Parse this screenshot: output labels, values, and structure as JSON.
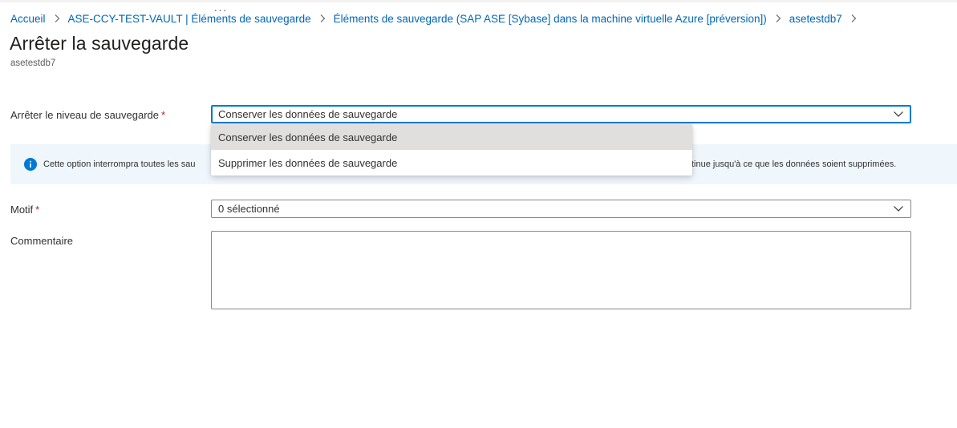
{
  "breadcrumb": {
    "items": [
      "Accueil",
      "ASE-CCY-TEST-VAULT | Éléments de sauvegarde",
      "Éléments de sauvegarde (SAP ASE [Sybase] dans la machine virtuelle Azure [préversion])",
      "asetestdb7"
    ]
  },
  "header": {
    "title": "Arrêter la sauvegarde",
    "more_label": "···",
    "subtitle": "asetestdb7"
  },
  "form": {
    "stop_level": {
      "label": "Arrêter le niveau de sauvegarde",
      "required_mark": "*",
      "value": "Conserver les données de sauvegarde",
      "options": [
        "Conserver les données de sauvegarde",
        "Supprimer les données de sauvegarde"
      ]
    },
    "info": {
      "text_visible_left": "Cette option interrompra toutes les sau",
      "text_visible_right": "tinue jusqu'à ce que les données soient supprimées."
    },
    "reason": {
      "label": "Motif",
      "required_mark": "*",
      "value": "0 sélectionné"
    },
    "comment": {
      "label": "Commentaire",
      "value": ""
    }
  },
  "colors": {
    "link": "#0067b8",
    "accent": "#0078d4",
    "info_background": "#eff6fc",
    "required": "#a4262c",
    "menu_selected": "#e1dfdd"
  }
}
